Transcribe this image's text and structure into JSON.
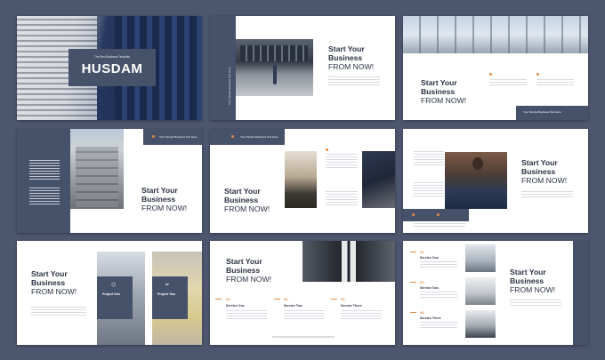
{
  "s1": {
    "tagline": "The Best Business Template",
    "title": "HUSDAM"
  },
  "heading": {
    "l1": "Start Your",
    "l2": "Business",
    "l3": "FROM NOW!"
  },
  "business_text": "Your Simple Business Text Here",
  "services": {
    "one": "Service One",
    "two": "Service Two",
    "three": "Service Three"
  },
  "numbers": {
    "n1": "01.",
    "n2": "02.",
    "n3": "03."
  },
  "projects": {
    "one": "Project One",
    "two": "Project Two"
  },
  "colors": {
    "navy": "#46516a",
    "background": "#4d566f",
    "accent": "#e08a45"
  }
}
